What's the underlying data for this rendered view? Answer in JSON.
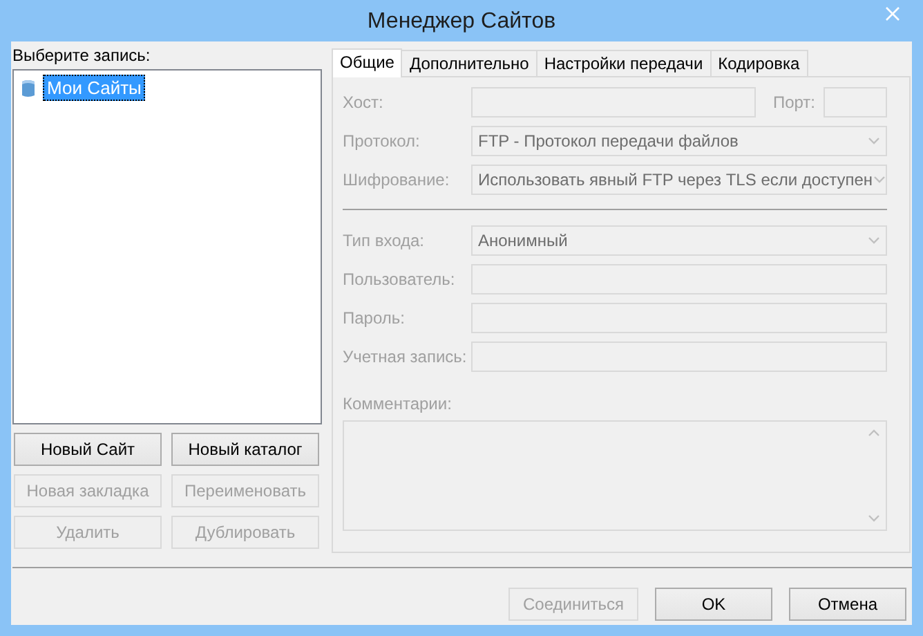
{
  "window": {
    "title": "Менеджер Сайтов"
  },
  "site_list": {
    "label": "Выберите запись:",
    "items": [
      {
        "label": "Мои Сайты",
        "selected": true
      }
    ]
  },
  "site_buttons": [
    {
      "label": "Новый Сайт",
      "disabled": false
    },
    {
      "label": "Новый каталог",
      "disabled": false
    },
    {
      "label": "Новая закладка",
      "disabled": true
    },
    {
      "label": "Переименовать",
      "disabled": true
    },
    {
      "label": "Удалить",
      "disabled": true
    },
    {
      "label": "Дублировать",
      "disabled": true
    }
  ],
  "tabs": [
    {
      "label": "Общие",
      "selected": true
    },
    {
      "label": "Дополнительно",
      "selected": false
    },
    {
      "label": "Настройки передачи",
      "selected": false
    },
    {
      "label": "Кодировка",
      "selected": false
    }
  ],
  "server_fields": [
    {
      "kind": "text",
      "label": "Хост:",
      "disabled": true,
      "side": {
        "label": "Порт:"
      }
    },
    {
      "kind": "select",
      "label": "Протокол:",
      "value": "FTP - Протокол передачи файлов",
      "disabled": true
    },
    {
      "kind": "select",
      "label": "Шифрование:",
      "value": "Использовать явный FTP через TLS если доступен",
      "disabled": true
    }
  ],
  "login_fields": [
    {
      "kind": "select",
      "label": "Тип входа:",
      "value": "Анонимный",
      "disabled": true
    },
    {
      "kind": "text",
      "label": "Пользователь:",
      "disabled": true
    },
    {
      "kind": "text",
      "label": "Пароль:",
      "disabled": true
    },
    {
      "kind": "text",
      "label": "Учетная запись:",
      "disabled": true
    }
  ],
  "comments": {
    "label": "Комментарии:",
    "disabled": true
  },
  "footer_buttons": [
    {
      "label": "Соединиться",
      "disabled": true
    },
    {
      "label": "OK",
      "disabled": false
    },
    {
      "label": "Отмена",
      "disabled": false
    }
  ]
}
